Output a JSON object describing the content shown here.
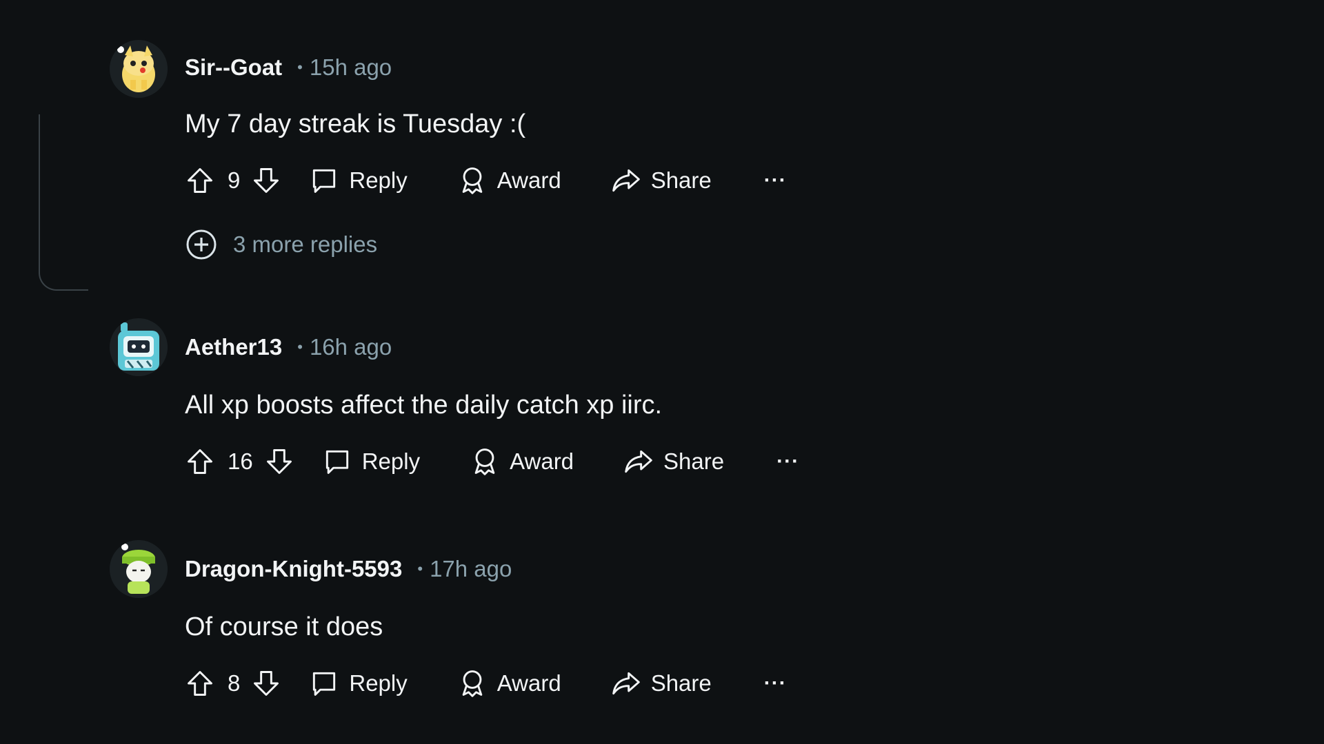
{
  "comments": [
    {
      "author": "Sir--Goat",
      "time": "15h ago",
      "text": "My 7 day streak is Tuesday :(",
      "votes": "9",
      "more_replies": "3 more replies"
    },
    {
      "author": "Aether13",
      "time": "16h ago",
      "text": "All xp boosts affect the daily catch xp iirc.",
      "votes": "16"
    },
    {
      "author": "Dragon-Knight-5593",
      "time": "17h ago",
      "text": "Of course it does",
      "votes": "8"
    }
  ],
  "actions": {
    "reply": "Reply",
    "award": "Award",
    "share": "Share",
    "more": "···"
  },
  "separator": "•",
  "colors": {
    "background": "#0e1113",
    "text": "#f2f4f5",
    "muted": "#8ba2ad"
  }
}
